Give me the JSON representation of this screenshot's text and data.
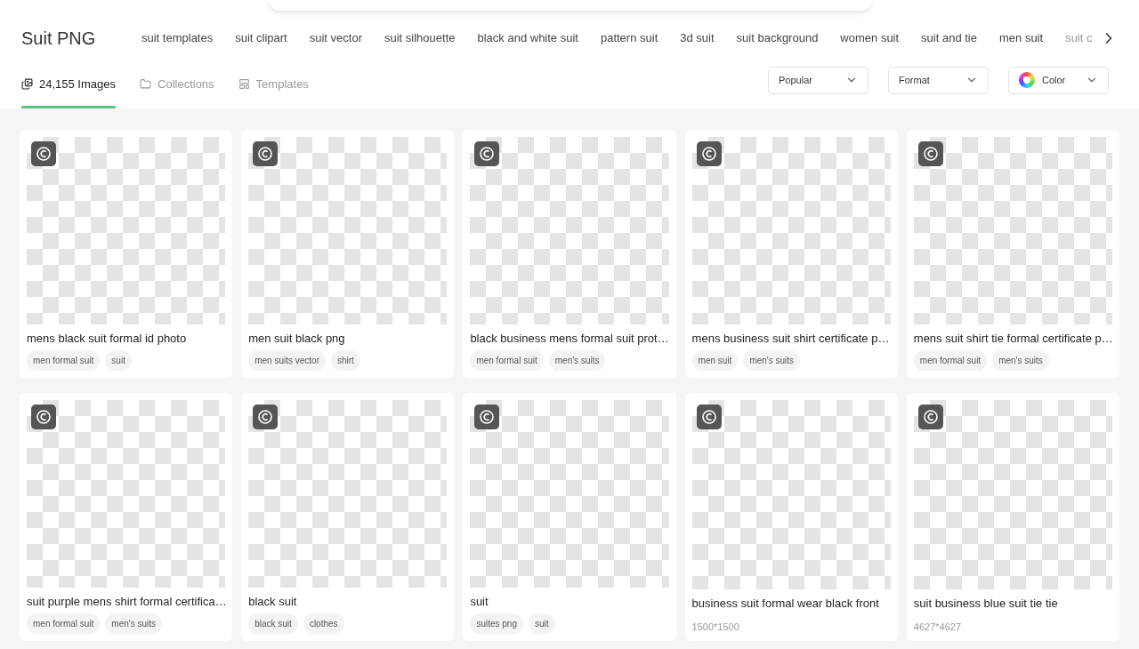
{
  "search_bar_visible": true,
  "title": "Suit PNG",
  "related_tags": [
    "suit templates",
    "suit clipart",
    "suit vector",
    "suit silhouette",
    "black and white suit",
    "pattern suit",
    "3d suit",
    "suit background",
    "women suit",
    "suit and tie",
    "men suit",
    "suit c"
  ],
  "tabs": [
    {
      "label": "24,155 Images",
      "selected": true
    },
    {
      "label": "Collections",
      "selected": false
    },
    {
      "label": "Templates",
      "selected": false
    }
  ],
  "filters": [
    {
      "kind": "plain",
      "label": "Popular"
    },
    {
      "kind": "plain",
      "label": "Format"
    },
    {
      "kind": "color",
      "label": "Color"
    }
  ],
  "cards": [
    {
      "title": "mens black suit formal id photo",
      "tags": [
        "men formal suit",
        "suit"
      ]
    },
    {
      "title": "men suit black png",
      "tags": [
        "men suits vector",
        "shirt"
      ]
    },
    {
      "title": "black business mens formal suit prot…",
      "tags": [
        "men formal suit",
        "men's suits"
      ]
    },
    {
      "title": "mens business suit shirt certificate p…",
      "tags": [
        "men suit",
        "men's suits"
      ]
    },
    {
      "title": "mens suit shirt tie formal certificate p…",
      "tags": [
        "men formal suit",
        "men's suits"
      ]
    },
    {
      "title": "suit purple mens shirt formal certifica…",
      "tags": [
        "men formal suit",
        "men's suits"
      ]
    },
    {
      "title": "black suit",
      "tags": [
        "black suit",
        "clothes"
      ]
    },
    {
      "title": "suit",
      "tags": [
        "suites png",
        "suit"
      ]
    },
    {
      "title": "business suit formal wear black front",
      "dimensions": "1500*1500"
    },
    {
      "title": "suit business blue suit tie tie",
      "dimensions": "4627*4627"
    }
  ]
}
